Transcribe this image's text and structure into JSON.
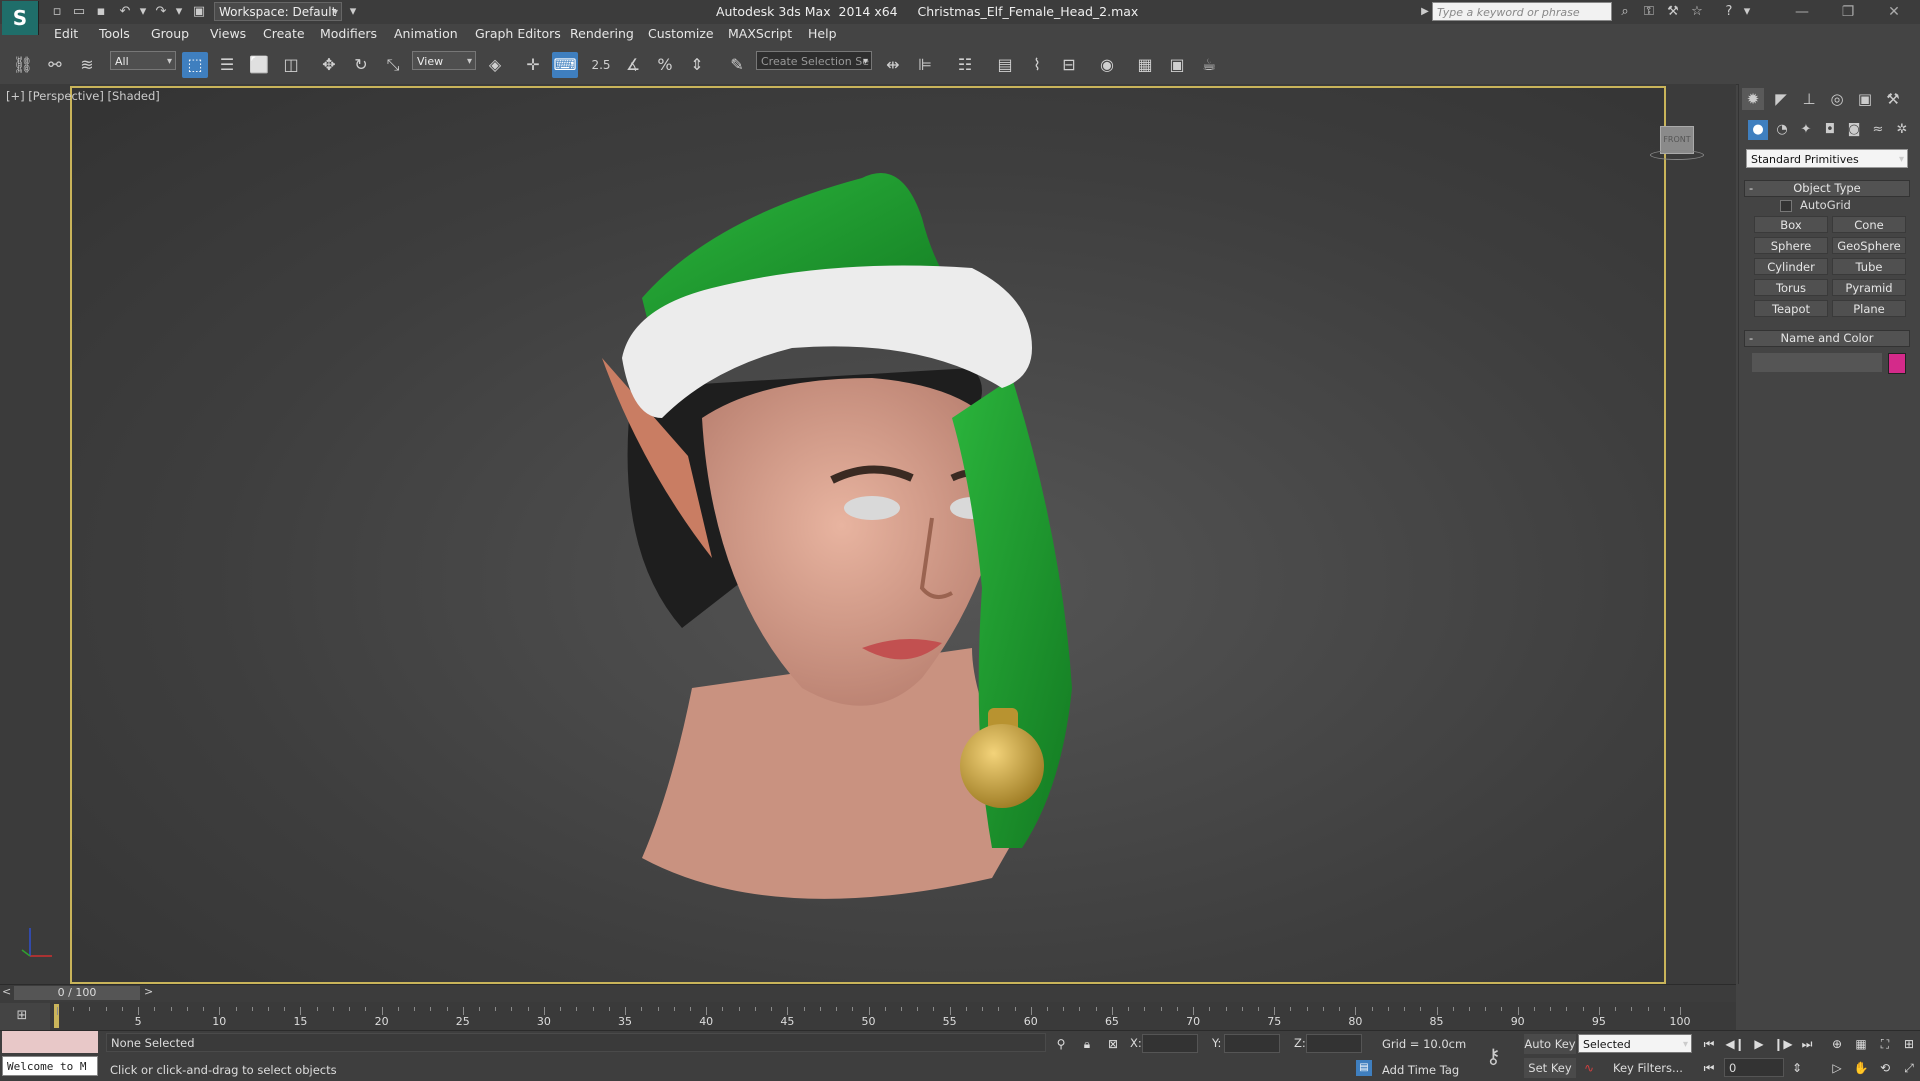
{
  "app": {
    "title": "Autodesk 3ds Max  2014 x64     Christmas_Elf_Female_Head_2.max",
    "workspace": "Workspace: Default",
    "search_placeholder": "Type a keyword or phrase"
  },
  "menu": [
    "Edit",
    "Tools",
    "Group",
    "Views",
    "Create",
    "Modifiers",
    "Animation",
    "Graph Editors",
    "Rendering",
    "Customize",
    "MAXScript",
    "Help"
  ],
  "toolbar": {
    "selection_filter": "All",
    "ref_coord": "View",
    "snap_value": "2.5",
    "named_selection_placeholder": "Create Selection Se"
  },
  "viewport": {
    "label": "[+] [Perspective] [Shaded]",
    "viewcube_label": "FRONT",
    "colors": {
      "border": "#c9b45a",
      "hat": "#1f9a2e",
      "skin": "#d8a08a",
      "hair": "#222222",
      "fur": "#f0f0f0",
      "bell": "#c9a23e"
    }
  },
  "command_panel": {
    "category": "Standard Primitives",
    "object_type_title": "Object Type",
    "autogrid_label": "AutoGrid",
    "primitives": [
      "Box",
      "Cone",
      "Sphere",
      "GeoSphere",
      "Cylinder",
      "Tube",
      "Torus",
      "Pyramid",
      "Teapot",
      "Plane"
    ],
    "name_color_title": "Name and Color",
    "object_color": "#d42a8a",
    "rollout_minus": "-"
  },
  "timeline": {
    "frame_display": "0 / 100",
    "prev_arrow": "<",
    "next_arrow": ">",
    "ticks": [
      "5",
      "10",
      "15",
      "20",
      "25",
      "30",
      "35",
      "40",
      "45",
      "50",
      "55",
      "60",
      "65",
      "70",
      "75",
      "80",
      "85",
      "90",
      "95",
      "100"
    ]
  },
  "status": {
    "welcome": "Welcome to M",
    "selection": "None Selected",
    "prompt": "Click or click-and-drag to select objects",
    "x_label": "X:",
    "y_label": "Y:",
    "z_label": "Z:",
    "grid": "Grid = 10.0cm",
    "add_time_tag": "Add Time Tag",
    "auto_key": "Auto Key",
    "set_key": "Set Key",
    "key_mode": "Selected",
    "key_filters": "Key Filters...",
    "current_frame": "0"
  }
}
